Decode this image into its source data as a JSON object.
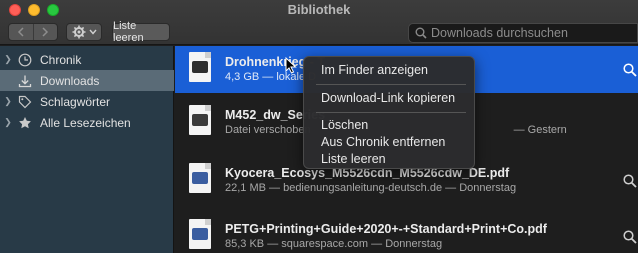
{
  "window": {
    "title": "Bibliothek"
  },
  "toolbar": {
    "clear_label": "Liste leeren",
    "search_placeholder": "Downloads durchsuchen"
  },
  "sidebar": {
    "items": [
      {
        "label": "Chronik",
        "icon": "clock-icon"
      },
      {
        "label": "Downloads",
        "icon": "download-icon",
        "selected": true
      },
      {
        "label": "Schlagwörter",
        "icon": "tag-icon"
      },
      {
        "label": "Alle Lesezeichen",
        "icon": "star-icon"
      }
    ]
  },
  "downloads": [
    {
      "name": "Drohnenkrieg - T",
      "meta": "4,3 GB — lokale D",
      "selected": true,
      "accent": "#2d2d2d"
    },
    {
      "name": "M452_dw_Series_",
      "meta": "Datei verschoben",
      "meta_tail": "— Gestern",
      "accent": "#3a3a3a"
    },
    {
      "name": "Kyocera_Ecosys_M5526cdn_M5526cdw_DE.pdf",
      "meta": "22,1 MB — bedienungsanleitung-deutsch.de — Donnerstag",
      "accent": "#3a5da0"
    },
    {
      "name": "PETG+Printing+Guide+2020+-+Standard+Print+Co.pdf",
      "meta": "85,3 KB — squarespace.com — Donnerstag",
      "accent": "#3a5da0"
    }
  ],
  "context_menu": {
    "items": [
      "Im Finder anzeigen",
      "Download-Link kopieren",
      "Löschen",
      "Aus Chronik entfernen",
      "Liste leeren"
    ]
  },
  "colors": {
    "selection": "#1a5fd6",
    "sidebar": "#283a47",
    "sidebar_selected": "#5a6b77"
  }
}
